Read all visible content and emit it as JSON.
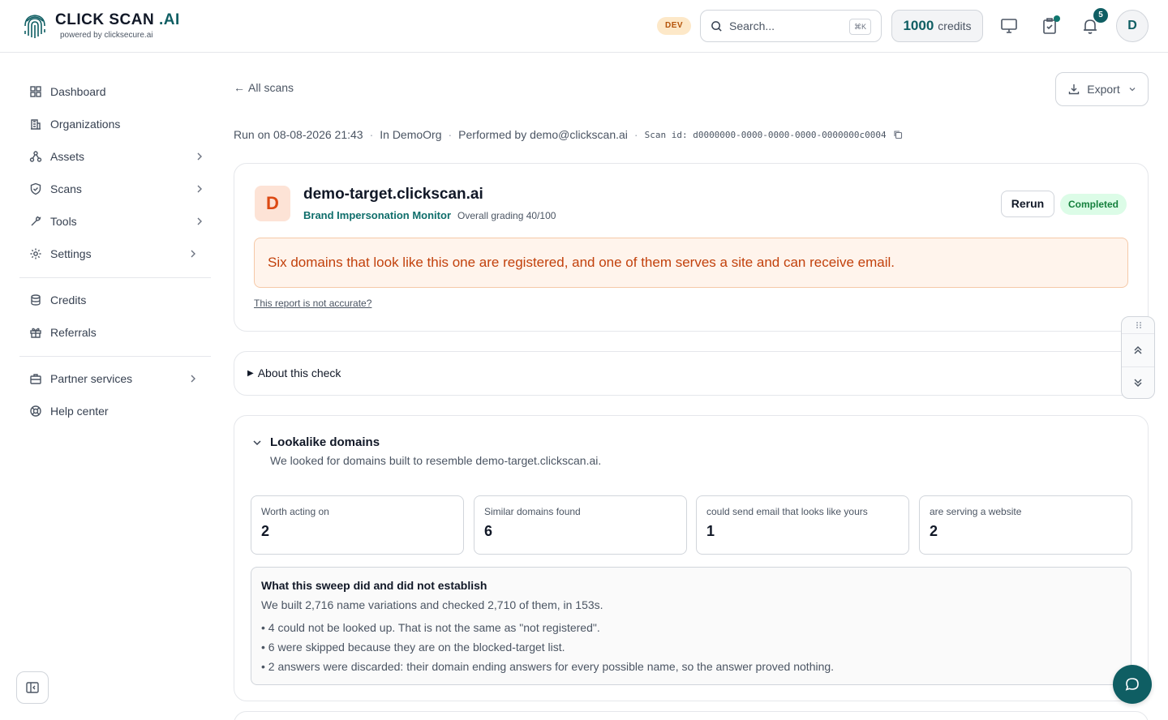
{
  "brand": {
    "title_main": "CLICK SCAN",
    "title_accent": ".AI",
    "tagline": "powered by clicksecure.ai"
  },
  "header": {
    "env_badge": "DEV",
    "search": {
      "placeholder": "Search...",
      "shortcut": "⌘K"
    },
    "credits": {
      "amount": "1000",
      "label": "credits"
    },
    "notifications_count": "5",
    "avatar_initial": "D"
  },
  "sidebar": {
    "items": [
      {
        "label": "Dashboard",
        "icon": "dashboard-icon"
      },
      {
        "label": "Organizations",
        "icon": "building-icon"
      },
      {
        "label": "Assets",
        "icon": "assets-icon",
        "has_children": true
      },
      {
        "label": "Scans",
        "icon": "shield-icon",
        "has_children": true
      },
      {
        "label": "Tools",
        "icon": "tools-icon",
        "has_children": true
      },
      {
        "label": "Settings",
        "icon": "gear-icon",
        "has_children": true
      },
      {
        "label": "Credits",
        "icon": "coins-icon"
      },
      {
        "label": "Referrals",
        "icon": "gift-icon"
      },
      {
        "label": "Partner services",
        "icon": "briefcase-icon",
        "has_children": true
      },
      {
        "label": "Help center",
        "icon": "lifebuoy-icon"
      }
    ]
  },
  "page": {
    "back_label": "All scans",
    "export_label": "Export",
    "meta": {
      "run_on": "Run on 08-08-2026 21:43",
      "org": "In DemoOrg",
      "performed_by": "Performed by demo@clickscan.ai",
      "scan_id": "Scan id: d0000000-0000-0000-0000-0000000c0004"
    }
  },
  "result": {
    "avatar_letter": "D",
    "target": "demo-target.clickscan.ai",
    "monitor": "Brand Impersonation Monitor",
    "grading": "Overall grading 40/100",
    "rerun_label": "Rerun",
    "status": "Completed",
    "summary": "Six domains that look like this one are registered, and one of them serves a site and can receive email.",
    "feedback_link": "This report is not accurate?"
  },
  "about": {
    "label": "About this check"
  },
  "lookalike": {
    "title": "Lookalike domains",
    "description": "We looked for domains built to resemble demo-target.clickscan.ai.",
    "stats": [
      {
        "label": "Worth acting on",
        "value": "2"
      },
      {
        "label": "Similar domains found",
        "value": "6"
      },
      {
        "label": "could send email that looks like yours",
        "value": "1"
      },
      {
        "label": "are serving a website",
        "value": "2"
      }
    ],
    "sweep": {
      "title": "What this sweep did and did not establish",
      "summary": "We built 2,716 name variations and checked 2,710 of them, in 153s.",
      "bullets": [
        "• 4 could not be looked up. That is not the same as \"not registered\".",
        "• 6 were skipped because they are on the blocked-target list.",
        "• 2 answers were discarded: their domain ending answers for every possible name, so the answer proved nothing."
      ]
    }
  },
  "colors": {
    "brand": "#0f5e63",
    "warning_text": "#c2410c",
    "warning_bg": "#fff4ec",
    "success_bg": "#dcfce7",
    "success_text": "#15803d"
  }
}
